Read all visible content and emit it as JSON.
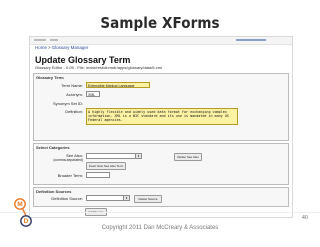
{
  "slide": {
    "title": "Sample XForms",
    "copyright": "Copyright  2011 Dan McCreary & Associates",
    "page_number": "40"
  },
  "logo": {
    "letters": [
      "M",
      "D"
    ],
    "color": "#e87722"
  },
  "app": {
    "breadcrumb": [
      "Home",
      "Glossary Manager"
    ],
    "page_title": "Update Glossary Term",
    "file_path": "Glossary Editor - 0.05 - File: /exist/rest/db/mdr/apps/glossary/data/6.xml",
    "sections": {
      "term": {
        "title": "Glossary Term",
        "term_name_label": "Term Name:",
        "term_name_value": "Extensible Markup Language",
        "acronym_label": "Acronym:",
        "acronym_value": "XML",
        "synonym_label": "Synonym Set ID:",
        "definition_label": "Definition:",
        "definition_value": "A highly flexible and widely used data format for exchanging complex information. XML is a W3C standard and its use is mandated in many US Federal agencies."
      },
      "categories": {
        "title": "Select Categories",
        "see_also_label": "See Also:",
        "see_also_note": "(comma-separated)",
        "delete_see_also": "Delete See Also",
        "insert_see_also": "Insert New See Also Term",
        "broader_label": "Broader Term:"
      },
      "sources": {
        "title": "Definition Sources",
        "source_label": "Definition Source:",
        "delete_source": "Delete Source",
        "add_source": "Add Source"
      }
    }
  }
}
